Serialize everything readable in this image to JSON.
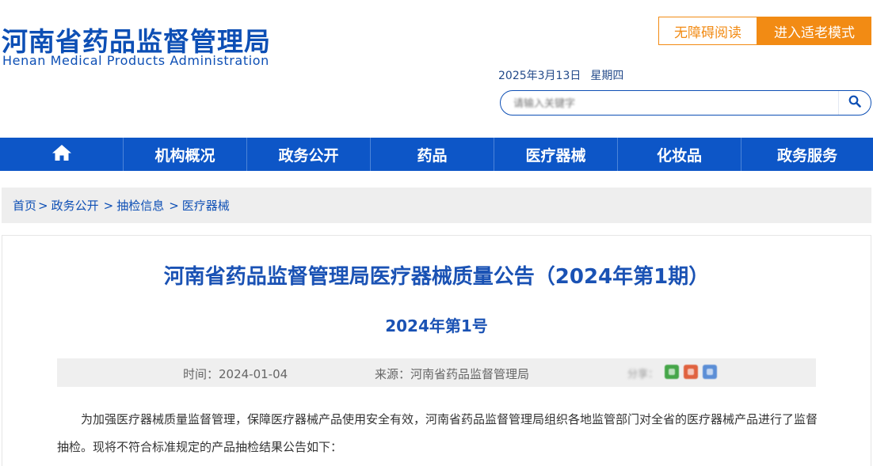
{
  "header": {
    "logo_cn": "河南省药品监督管理局",
    "logo_en": "Henan Medical Products Administration",
    "accessibility_button": "无障碍阅读",
    "elder_mode_button": "进入适老模式",
    "date": "2025年3月13日",
    "weekday": "星期四",
    "search_placeholder": "请输入关键字"
  },
  "nav": {
    "items": [
      {
        "label": ""
      },
      {
        "label": "机构概况"
      },
      {
        "label": "政务公开"
      },
      {
        "label": "药品"
      },
      {
        "label": "医疗器械"
      },
      {
        "label": "化妆品"
      },
      {
        "label": "政务服务"
      }
    ]
  },
  "breadcrumb": {
    "items": [
      "首页",
      "政务公开",
      "抽检信息",
      "医疗器械"
    ],
    "separator": ">"
  },
  "article": {
    "title": "河南省药品监督管理局医疗器械质量公告（2024年第1期）",
    "subtitle": "2024年第1号",
    "time_label": "时间：2024-01-04",
    "source_label": "来源：河南省药品监督管理局",
    "share_label": "分享：",
    "paragraph": "为加强医疗器械质量监督管理，保障医疗器械产品使用安全有效，河南省药品监督管理局组织各地监管部门对全省的医疗器械产品进行了监督抽检。现将不符合标准规定的产品抽检结果公告如下："
  },
  "colors": {
    "brand_blue": "#0d56c7",
    "title_blue": "#1a52b4",
    "accent_orange": "#f28b14",
    "breadcrumb_bg": "#eeeeee"
  },
  "icons": {
    "home": "home-icon",
    "search": "search-icon",
    "share": [
      "wechat-icon",
      "weibo-icon",
      "qzone-icon"
    ]
  }
}
